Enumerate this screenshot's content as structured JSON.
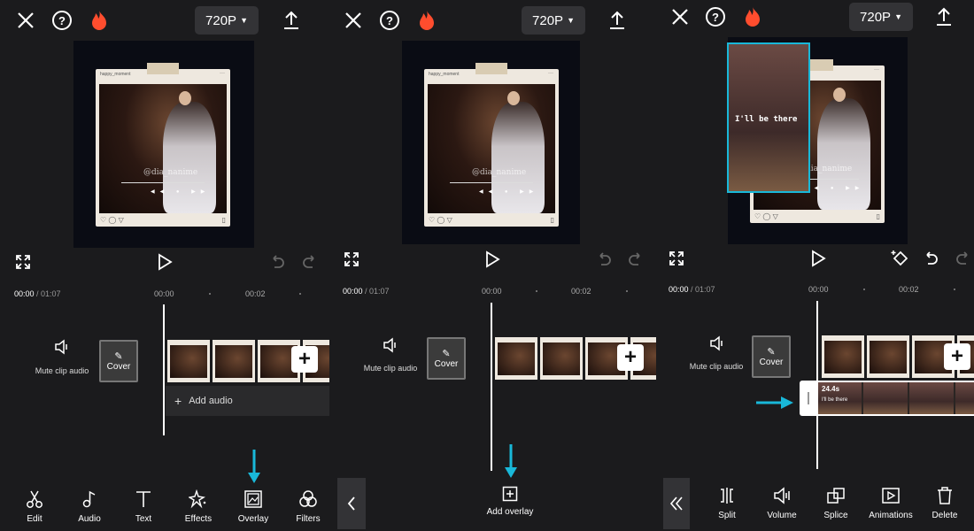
{
  "panel1": {
    "resolution": "720P",
    "timecode_current": "00:00",
    "timecode_total": " / 01:07",
    "ticks": [
      "00:00",
      "00:02"
    ],
    "mute_label": "Mute clip audio",
    "cover_label": "Cover",
    "add_audio_label": "Add audio",
    "tools": [
      {
        "label": "Edit",
        "icon": "scissors-icon"
      },
      {
        "label": "Audio",
        "icon": "music-note-icon"
      },
      {
        "label": "Text",
        "icon": "text-icon"
      },
      {
        "label": "Effects",
        "icon": "sparkle-icon"
      },
      {
        "label": "Overlay",
        "icon": "overlay-icon"
      },
      {
        "label": "Filters",
        "icon": "filters-icon"
      }
    ]
  },
  "panel2": {
    "resolution": "720P",
    "timecode_current": "00:00",
    "timecode_total": " / 01:07",
    "ticks": [
      "00:00",
      "00:02"
    ],
    "mute_label": "Mute clip audio",
    "cover_label": "Cover",
    "add_overlay_label": "Add overlay"
  },
  "panel3": {
    "resolution": "720P",
    "timecode_current": "00:00",
    "timecode_total": " / 01:07",
    "ticks": [
      "00:00",
      "00:02"
    ],
    "mute_label": "Mute clip audio",
    "cover_label": "Cover",
    "overlay_duration": "24.4s",
    "overlay_text": "I'll be there",
    "tools": [
      {
        "label": "Split",
        "icon": "split-icon"
      },
      {
        "label": "Volume",
        "icon": "volume-icon"
      },
      {
        "label": "Splice",
        "icon": "splice-icon"
      },
      {
        "label": "Animations",
        "icon": "animations-icon"
      },
      {
        "label": "Delete",
        "icon": "trash-icon"
      }
    ]
  },
  "photo": {
    "header": "happy_moment",
    "menu": "···",
    "watermark": "@dia_nanime",
    "controls": "◀◀ ● ▶▶",
    "footer": "♡ ◯ ▽",
    "bookmark": "▯"
  },
  "colors": {
    "background": "#1b1b1d",
    "accent_cyan": "#19b8d9",
    "flame": "#ff4d2e",
    "res_button": "#333336"
  }
}
